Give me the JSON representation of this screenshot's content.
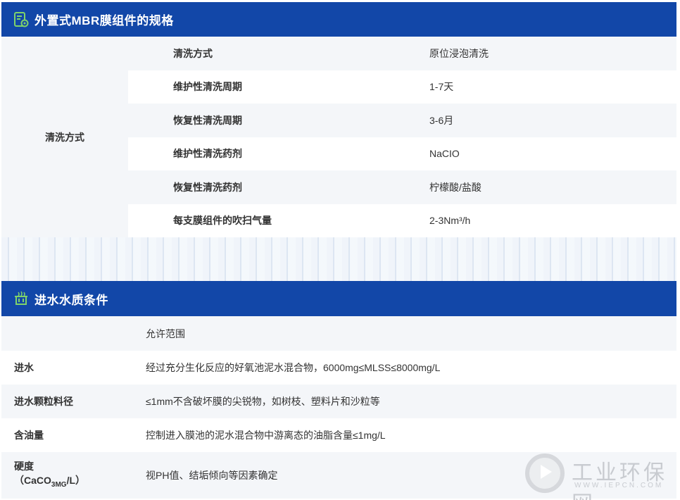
{
  "section1": {
    "title": "外置式MBR膜组件的规格",
    "icon": "spec-document-icon",
    "group_label": "清洗方式",
    "rows": [
      {
        "key": "清洗方式",
        "value": "原位浸泡清洗"
      },
      {
        "key": "维护性清洗周期",
        "value": "1-7天"
      },
      {
        "key": "恢复性清洗周期",
        "value": "3-6月"
      },
      {
        "key": "维护性清洗药剂",
        "value": "NaCIO"
      },
      {
        "key": "恢复性清洗药剂",
        "value": "柠檬酸/盐酸"
      },
      {
        "key": "每支膜组件的吹扫气量",
        "value": "2-3Nm³/h"
      }
    ]
  },
  "section2": {
    "title": "进水水质条件",
    "icon": "water-basin-icon",
    "header_value": "允许范围",
    "rows": [
      {
        "key": "进水",
        "value": "经过充分生化反应的好氧池泥水混合物，6000mg≤MLSS≤8000mg/L"
      },
      {
        "key": "进水颗粒料径",
        "value": "≤1mm不含破坏膜的尖锐物，如树枝、塑料片和沙粒等"
      },
      {
        "key": "含油量",
        "value": "控制进入膜池的泥水混合物中游离态的油脂含量≤1mg/L"
      },
      {
        "key_line1": "硬度",
        "key_line2_pre": "（CaCO",
        "key_line2_sub": "3MG",
        "key_line2_post": "/L）",
        "value": "视PH值、结垢倾向等因素确定"
      }
    ]
  },
  "watermark": {
    "text": "工业环保网",
    "url": "WWW.IEPCN.COM"
  },
  "colors": {
    "header_bg": "#1247a8",
    "row_shade": "#f4f6f9",
    "icon_accent": "#7fd36a"
  }
}
